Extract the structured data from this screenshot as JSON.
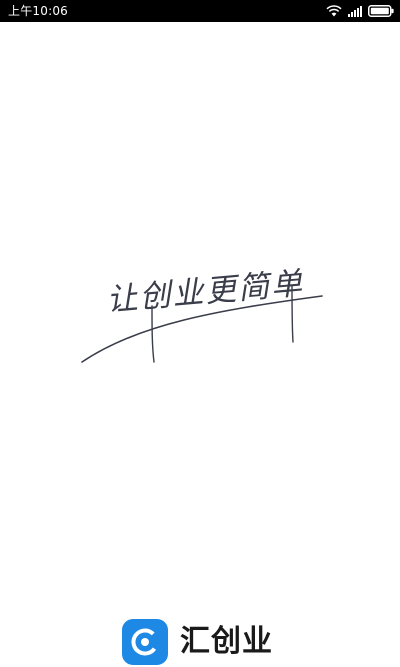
{
  "status_bar": {
    "time": "上午10:06",
    "icons": [
      "wifi-icon",
      "signal-icon",
      "battery-icon"
    ]
  },
  "splash": {
    "slogan": "让创业更简单",
    "slogan_color": "#3a3d4a",
    "brand": {
      "name": "汇创业",
      "icon": "app-logo-icon",
      "icon_color": "#1E88E5"
    }
  }
}
